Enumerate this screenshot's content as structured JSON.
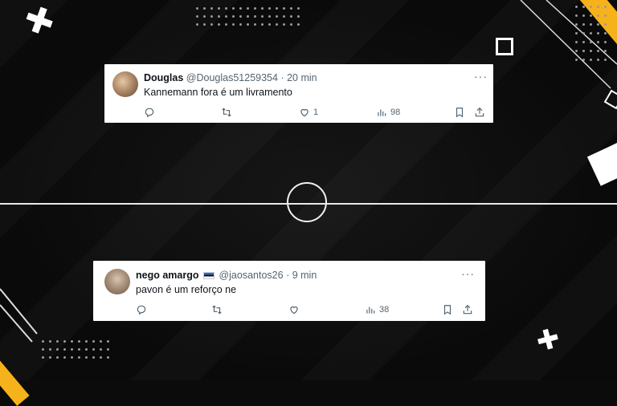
{
  "tweets": [
    {
      "name": "Douglas",
      "handle": "@Douglas51259354",
      "separator": "·",
      "time": "20 min",
      "text": "Kannemann fora é um livramento",
      "more_icon": "···",
      "reply_count": "",
      "retweet_count": "",
      "like_count": "1",
      "view_count": "98"
    },
    {
      "name": "nego amargo",
      "handle": "@jaosantos26",
      "separator": "·",
      "time": "9 min",
      "text": "pavon é um reforço ne",
      "more_icon": "···",
      "reply_count": "",
      "retweet_count": "",
      "like_count": "",
      "view_count": "38"
    }
  ],
  "colors": {
    "accent_yellow": "#f6b21a",
    "background": "#0b0b0b",
    "tweet_bg": "#ffffff",
    "muted_text": "#536471"
  },
  "icons": [
    "reply-icon",
    "retweet-icon",
    "like-icon",
    "views-icon",
    "bookmark-icon",
    "share-icon",
    "more-icon",
    "flag-icon"
  ]
}
